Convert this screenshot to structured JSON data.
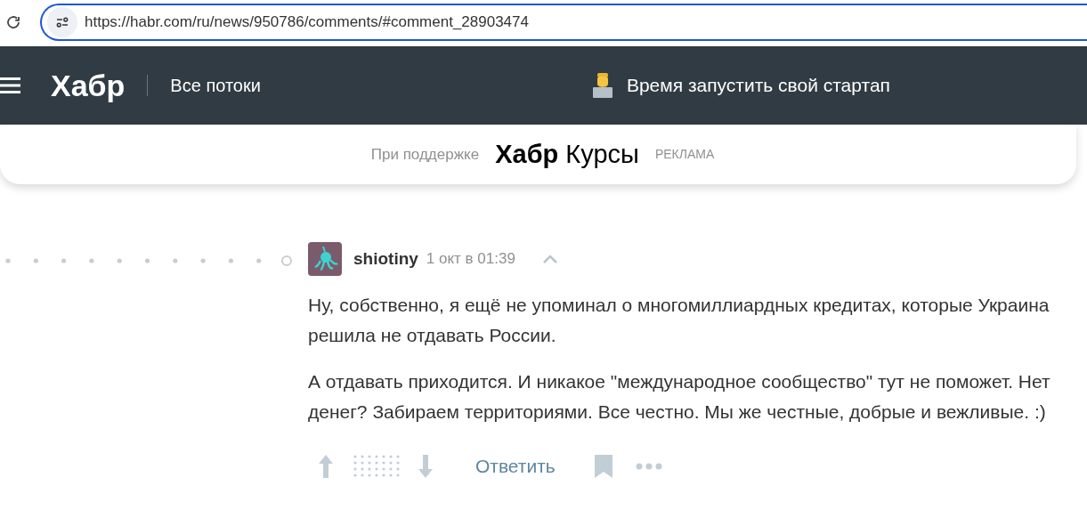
{
  "browser": {
    "url": "https://habr.com/ru/news/950786/comments/#comment_28903474"
  },
  "header": {
    "logo": "Хабр",
    "nav_link": "Все потоки",
    "promo": "Время запустить свой стартап"
  },
  "sponsor": {
    "label": "При поддержке",
    "brand_bold": "Хабр",
    "brand_light": "Курсы",
    "ad_label": "РЕКЛАМА"
  },
  "comment": {
    "author": "shiotiny",
    "time": "1 окт в 01:39",
    "paragraphs": [
      "Ну, собственно, я ещё не упоминал о многомиллиардных кредитах, которые Украина решила не отдавать России.",
      "А отдавать приходится. И никакое \"международное сообщество\" тут не поможет. Нет денег? Забираем территориями. Все честно. Мы же честные, добрые и вежливые. :)"
    ],
    "reply": "Ответить"
  }
}
